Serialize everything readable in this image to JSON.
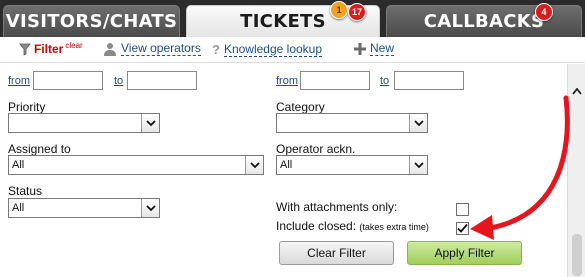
{
  "tabs": [
    {
      "label": "VISITORS/CHATS"
    },
    {
      "label": "TICKETS",
      "badges": [
        "1",
        "17"
      ]
    },
    {
      "label": "CALLBACKS",
      "badges": [
        "4"
      ]
    }
  ],
  "toolbar": {
    "filter_label": "Filter",
    "clear_label": "clear",
    "view_operators": "View operators",
    "knowledge_lookup": "Knowledge lookup",
    "new_label": "New"
  },
  "filters": {
    "from_label": "from",
    "to_label": "to",
    "from2_label": "from",
    "to2_label": "to",
    "priority_label": "Priority",
    "priority_value": "",
    "category_label": "Category",
    "category_value": "",
    "assigned_label": "Assigned to",
    "assigned_value": "All",
    "operator_ack_label": "Operator ackn.",
    "operator_ack_value": "All",
    "status_label": "Status",
    "status_value": "All",
    "attachments_label": "With attachments only:",
    "include_closed_label": "Include closed:",
    "include_closed_note": "(takes extra time)"
  },
  "buttons": {
    "clear_filter": "Clear Filter",
    "apply_filter": "Apply Filter"
  },
  "colors": {
    "accent_red": "#e8141c",
    "link_blue": "#1d4e8f",
    "apply_green": "#9fcf5c"
  }
}
